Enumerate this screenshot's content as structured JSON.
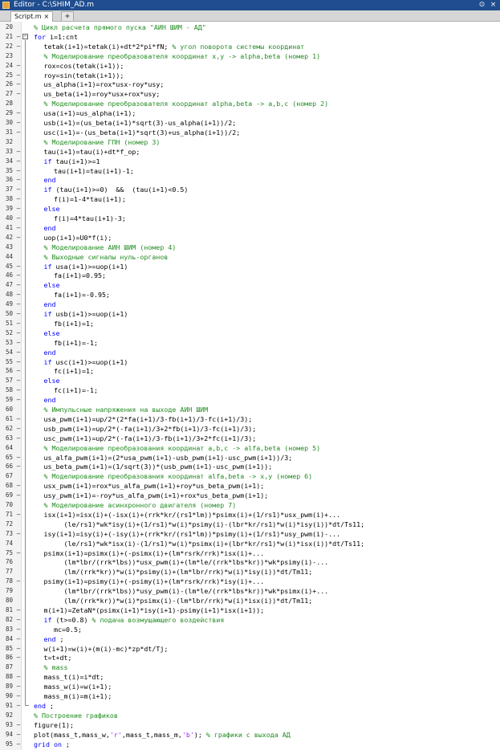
{
  "window": {
    "title": "Editor - C:\\SHIM_AD.m",
    "menu_icon": "chevron-down-circle-icon",
    "close_icon": "close-icon"
  },
  "tabs": {
    "active": "Script.m",
    "close_glyph": "×",
    "add_glyph": "+"
  },
  "colors": {
    "keyword": "#0000ff",
    "comment": "#228b22",
    "string": "#a020f0",
    "titlebar": "#1f4d8f"
  },
  "editor": {
    "lines": [
      {
        "n": "20",
        "m": "",
        "ind": 0,
        "fold": "",
        "t": [
          [
            "cm",
            "% Цикл расчета прямого пуска \"АИН ШИМ - АД\""
          ]
        ]
      },
      {
        "n": "21",
        "m": "—",
        "ind": 0,
        "fold": "open",
        "t": [
          [
            "kw",
            "for"
          ],
          [
            "",
            "i=1:cnt"
          ]
        ]
      },
      {
        "n": "22",
        "m": "—",
        "ind": 1,
        "fold": "",
        "t": [
          [
            "",
            "tetak(i+1)=tetak(i)+dt*2*pi*fN; "
          ],
          [
            "cm",
            "% угол поворота системы координат"
          ]
        ]
      },
      {
        "n": "23",
        "m": "",
        "ind": 1,
        "fold": "",
        "t": [
          [
            "cm",
            "% Моделирование преобразователя координат x,y -> alpha,beta (номер 1)"
          ]
        ]
      },
      {
        "n": "24",
        "m": "—",
        "ind": 1,
        "fold": "",
        "t": [
          [
            "",
            "rox=cos(tetak(i+1));"
          ]
        ]
      },
      {
        "n": "25",
        "m": "—",
        "ind": 1,
        "fold": "",
        "t": [
          [
            "",
            "roy=sin(tetak(i+1));"
          ]
        ]
      },
      {
        "n": "26",
        "m": "—",
        "ind": 1,
        "fold": "",
        "t": [
          [
            "",
            "us_alpha(i+1)=rox*usx-roy*usy;"
          ]
        ]
      },
      {
        "n": "27",
        "m": "—",
        "ind": 1,
        "fold": "",
        "t": [
          [
            "",
            "us_beta(i+1)=roy*usx+rox*usy;"
          ]
        ]
      },
      {
        "n": "28",
        "m": "",
        "ind": 1,
        "fold": "",
        "t": [
          [
            "cm",
            "% Моделирование преобразователя координат alpha,beta -> a,b,c (номер 2)"
          ]
        ]
      },
      {
        "n": "29",
        "m": "—",
        "ind": 1,
        "fold": "",
        "t": [
          [
            "",
            "usa(i+1)=us_alpha(i+1);"
          ]
        ]
      },
      {
        "n": "30",
        "m": "—",
        "ind": 1,
        "fold": "",
        "t": [
          [
            "",
            "usb(i+1)=(us_beta(i+1)*sqrt(3)-us_alpha(i+1))/2;"
          ]
        ]
      },
      {
        "n": "31",
        "m": "—",
        "ind": 1,
        "fold": "",
        "t": [
          [
            "",
            "usc(i+1)=-(us_beta(i+1)*sqrt(3)+us_alpha(i+1))/2;"
          ]
        ]
      },
      {
        "n": "32",
        "m": "",
        "ind": 1,
        "fold": "",
        "t": [
          [
            "cm",
            "% Моделирование ГПН (номер 3)"
          ]
        ]
      },
      {
        "n": "33",
        "m": "—",
        "ind": 1,
        "fold": "",
        "t": [
          [
            "",
            "tau(i+1)=tau(i)+dt*f_op;"
          ]
        ]
      },
      {
        "n": "34",
        "m": "—",
        "ind": 1,
        "fold": "",
        "t": [
          [
            "kw",
            "if"
          ],
          [
            "",
            "tau(i+1)>=1"
          ]
        ]
      },
      {
        "n": "35",
        "m": "—",
        "ind": 2,
        "fold": "",
        "t": [
          [
            "",
            "tau(i+1)=tau(i+1)-1;"
          ]
        ]
      },
      {
        "n": "36",
        "m": "—",
        "ind": 1,
        "fold": "",
        "t": [
          [
            "kw",
            "end"
          ]
        ]
      },
      {
        "n": "37",
        "m": "—",
        "ind": 1,
        "fold": "",
        "t": [
          [
            "kw",
            "if"
          ],
          [
            "",
            "(tau(i+1)>=0)  &&  (tau(i+1)<0.5)"
          ]
        ]
      },
      {
        "n": "38",
        "m": "—",
        "ind": 2,
        "fold": "",
        "t": [
          [
            "",
            "f(i)=1-4*tau(i+1);"
          ]
        ]
      },
      {
        "n": "39",
        "m": "—",
        "ind": 1,
        "fold": "",
        "t": [
          [
            "kw",
            "else"
          ]
        ]
      },
      {
        "n": "40",
        "m": "—",
        "ind": 2,
        "fold": "",
        "t": [
          [
            "",
            "f(i)=4*tau(i+1)-3;"
          ]
        ]
      },
      {
        "n": "41",
        "m": "—",
        "ind": 1,
        "fold": "",
        "t": [
          [
            "kw",
            "end"
          ]
        ]
      },
      {
        "n": "42",
        "m": "—",
        "ind": 1,
        "fold": "",
        "t": [
          [
            "",
            "uop(i+1)=U0*f(i);"
          ]
        ]
      },
      {
        "n": "43",
        "m": "",
        "ind": 1,
        "fold": "",
        "t": [
          [
            "cm",
            "% Моделирование АИН ШИМ (номер 4)"
          ]
        ]
      },
      {
        "n": "44",
        "m": "",
        "ind": 1,
        "fold": "",
        "t": [
          [
            "cm",
            "% Выходные сигналы нуль-органов"
          ]
        ]
      },
      {
        "n": "45",
        "m": "—",
        "ind": 1,
        "fold": "",
        "t": [
          [
            "kw",
            "if"
          ],
          [
            "",
            "usa(i+1)>=uop(i+1)"
          ]
        ]
      },
      {
        "n": "46",
        "m": "—",
        "ind": 2,
        "fold": "",
        "t": [
          [
            "",
            "fa(i+1)=0.95;"
          ]
        ]
      },
      {
        "n": "47",
        "m": "—",
        "ind": 1,
        "fold": "",
        "t": [
          [
            "kw",
            "else"
          ]
        ]
      },
      {
        "n": "48",
        "m": "—",
        "ind": 2,
        "fold": "",
        "t": [
          [
            "",
            "fa(i+1)=-0.95;"
          ]
        ]
      },
      {
        "n": "49",
        "m": "—",
        "ind": 1,
        "fold": "",
        "t": [
          [
            "kw",
            "end"
          ]
        ]
      },
      {
        "n": "50",
        "m": "—",
        "ind": 1,
        "fold": "",
        "t": [
          [
            "kw",
            "if"
          ],
          [
            "",
            "usb(i+1)>=uop(i+1)"
          ]
        ]
      },
      {
        "n": "51",
        "m": "—",
        "ind": 2,
        "fold": "",
        "t": [
          [
            "",
            "fb(i+1)=1;"
          ]
        ]
      },
      {
        "n": "52",
        "m": "—",
        "ind": 1,
        "fold": "",
        "t": [
          [
            "kw",
            "else"
          ]
        ]
      },
      {
        "n": "53",
        "m": "—",
        "ind": 2,
        "fold": "",
        "t": [
          [
            "",
            "fb(i+1)=-1;"
          ]
        ]
      },
      {
        "n": "54",
        "m": "—",
        "ind": 1,
        "fold": "",
        "t": [
          [
            "kw",
            "end"
          ]
        ]
      },
      {
        "n": "55",
        "m": "—",
        "ind": 1,
        "fold": "",
        "t": [
          [
            "kw",
            "if"
          ],
          [
            "",
            "usc(i+1)>=uop(i+1)"
          ]
        ]
      },
      {
        "n": "56",
        "m": "—",
        "ind": 2,
        "fold": "",
        "t": [
          [
            "",
            "fc(i+1)=1;"
          ]
        ]
      },
      {
        "n": "57",
        "m": "—",
        "ind": 1,
        "fold": "",
        "t": [
          [
            "kw",
            "else"
          ]
        ]
      },
      {
        "n": "58",
        "m": "—",
        "ind": 2,
        "fold": "",
        "t": [
          [
            "",
            "fc(i+1)=-1;"
          ]
        ]
      },
      {
        "n": "59",
        "m": "—",
        "ind": 1,
        "fold": "",
        "t": [
          [
            "kw",
            "end"
          ]
        ]
      },
      {
        "n": "60",
        "m": "",
        "ind": 1,
        "fold": "",
        "t": [
          [
            "cm",
            "% Импульсные напряжения на выходе АИН ШИМ"
          ]
        ]
      },
      {
        "n": "61",
        "m": "—",
        "ind": 1,
        "fold": "",
        "t": [
          [
            "",
            "usa_pwm(i+1)=up/2*(2*fa(i+1)/3-fb(i+1)/3-fc(i+1)/3);"
          ]
        ]
      },
      {
        "n": "62",
        "m": "—",
        "ind": 1,
        "fold": "",
        "t": [
          [
            "",
            "usb_pwm(i+1)=up/2*(-fa(i+1)/3+2*fb(i+1)/3-fc(i+1)/3);"
          ]
        ]
      },
      {
        "n": "63",
        "m": "—",
        "ind": 1,
        "fold": "",
        "t": [
          [
            "",
            "usc_pwm(i+1)=up/2*(-fa(i+1)/3-fb(i+1)/3+2*fc(i+1)/3);"
          ]
        ]
      },
      {
        "n": "64",
        "m": "",
        "ind": 1,
        "fold": "",
        "t": [
          [
            "cm",
            "% Моделирование преобразования координат a,b,c -> alfa,beta (номер 5)"
          ]
        ]
      },
      {
        "n": "65",
        "m": "—",
        "ind": 1,
        "fold": "",
        "t": [
          [
            "",
            "us_alfa_pwm(i+1)=(2*usa_pwm(i+1)-usb_pwm(i+1)-usc_pwm(i+1))/3;"
          ]
        ]
      },
      {
        "n": "66",
        "m": "—",
        "ind": 1,
        "fold": "",
        "t": [
          [
            "",
            "us_beta_pwm(i+1)=(1/sqrt(3))*(usb_pwm(i+1)-usc_pwm(i+1));"
          ]
        ]
      },
      {
        "n": "67",
        "m": "",
        "ind": 1,
        "fold": "",
        "t": [
          [
            "cm",
            "% Моделирование преобразования координат alfa,beta -> x,y (номер 6)"
          ]
        ]
      },
      {
        "n": "68",
        "m": "—",
        "ind": 1,
        "fold": "",
        "t": [
          [
            "",
            "usx_pwm(i+1)=rox*us_alfa_pwm(i+1)+roy*us_beta_pwm(i+1);"
          ]
        ]
      },
      {
        "n": "69",
        "m": "—",
        "ind": 1,
        "fold": "",
        "t": [
          [
            "",
            "usy_pwm(i+1)=-roy*us_alfa_pwm(i+1)+rox*us_beta_pwm(i+1);"
          ]
        ]
      },
      {
        "n": "70",
        "m": "",
        "ind": 1,
        "fold": "",
        "t": [
          [
            "cm",
            "% Моделирование асинхронного двигателя (номер 7)"
          ]
        ]
      },
      {
        "n": "71",
        "m": "—",
        "ind": 1,
        "fold": "",
        "t": [
          [
            "",
            "isx(i+1)=isx(i)+(-isx(i)+(rrk*kr/(rs1*lm))*psimx(i)+(1/rs1)*usx_pwm(i)+..."
          ]
        ]
      },
      {
        "n": "72",
        "m": "",
        "ind": 3,
        "fold": "",
        "t": [
          [
            "",
            "(le/rs1)*wk*isy(i)+(1/rs1)*w(i)*psimy(i)-(lbr*kr/rs1)*w(i)*isy(i))*dt/Ts11;"
          ]
        ]
      },
      {
        "n": "73",
        "m": "—",
        "ind": 1,
        "fold": "",
        "t": [
          [
            "",
            "isy(i+1)=isy(i)+(-isy(i)+(rrk*kr/(rs1*lm))*psimy(i)+(1/rs1)*usy_pwm(i)-..."
          ]
        ]
      },
      {
        "n": "74",
        "m": "",
        "ind": 3,
        "fold": "",
        "t": [
          [
            "",
            "(le/rs1)*wk*isx(i)-(1/rs1)*w(i)*psimx(i)+(lbr*kr/rs1)*w(i)*isx(i))*dt/Ts11;"
          ]
        ]
      },
      {
        "n": "75",
        "m": "—",
        "ind": 1,
        "fold": "",
        "t": [
          [
            "",
            "psimx(i+1)=psimx(i)+(-psimx(i)+(lm*rsrk/rrk)*isx(i)+..."
          ]
        ]
      },
      {
        "n": "76",
        "m": "",
        "ind": 3,
        "fold": "",
        "t": [
          [
            "",
            "(lm*lbr/(rrk*lbs))*usx_pwm(i)+(lm*le/(rrk*lbs*kr))*wk*psimy(i)-..."
          ]
        ]
      },
      {
        "n": "77",
        "m": "",
        "ind": 3,
        "fold": "",
        "t": [
          [
            "",
            "(lm/(rrk*kr))*w(i)*psimy(i)+(lm*lbr/rrk)*w(i)*isy(i))*dt/Tm11;"
          ]
        ]
      },
      {
        "n": "78",
        "m": "—",
        "ind": 1,
        "fold": "",
        "t": [
          [
            "",
            "psimy(i+1)=psimy(i)+(-psimy(i)+(lm*rsrk/rrk)*isy(i)+..."
          ]
        ]
      },
      {
        "n": "79",
        "m": "",
        "ind": 3,
        "fold": "",
        "t": [
          [
            "",
            "(lm*lbr/(rrk*lbs))*usy_pwm(i)-(lm*le/(rrk*lbs*kr))*wk*psimx(i)+..."
          ]
        ]
      },
      {
        "n": "80",
        "m": "",
        "ind": 3,
        "fold": "",
        "t": [
          [
            "",
            "(lm/(rrk*kr))*w(i)*psimx(i)-(lm*lbr/rrk)*w(i)*isx(i))*dt/Tm11;"
          ]
        ]
      },
      {
        "n": "81",
        "m": "—",
        "ind": 1,
        "fold": "",
        "t": [
          [
            "",
            "m(i+1)=ZetaN*(psimx(i+1)*isy(i+1)-psimy(i+1)*isx(i+1));"
          ]
        ]
      },
      {
        "n": "82",
        "m": "—",
        "ind": 1,
        "fold": "",
        "t": [
          [
            "kw",
            "if"
          ],
          [
            "",
            "(t>=0.8) "
          ],
          [
            "cm",
            "% подача возмущающего воздействия"
          ]
        ]
      },
      {
        "n": "83",
        "m": "—",
        "ind": 2,
        "fold": "",
        "t": [
          [
            "",
            "mc=0.5;"
          ]
        ]
      },
      {
        "n": "84",
        "m": "—",
        "ind": 1,
        "fold": "",
        "t": [
          [
            "kw",
            "end"
          ],
          [
            "",
            ";"
          ]
        ]
      },
      {
        "n": "85",
        "m": "—",
        "ind": 1,
        "fold": "",
        "t": [
          [
            "",
            "w(i+1)=w(i)+(m(i)-mc)*zp*dt/Tj;"
          ]
        ]
      },
      {
        "n": "86",
        "m": "—",
        "ind": 1,
        "fold": "",
        "t": [
          [
            "",
            "t=t+dt;"
          ]
        ]
      },
      {
        "n": "87",
        "m": "",
        "ind": 1,
        "fold": "",
        "t": [
          [
            "cm",
            "% mass"
          ]
        ]
      },
      {
        "n": "88",
        "m": "—",
        "ind": 1,
        "fold": "",
        "t": [
          [
            "",
            "mass_t(i)=i*dt;"
          ]
        ]
      },
      {
        "n": "89",
        "m": "—",
        "ind": 1,
        "fold": "",
        "t": [
          [
            "",
            "mass_w(i)=w(i+1);"
          ]
        ]
      },
      {
        "n": "90",
        "m": "—",
        "ind": 1,
        "fold": "",
        "t": [
          [
            "",
            "mass_m(i)=m(i+1);"
          ]
        ]
      },
      {
        "n": "91",
        "m": "—",
        "ind": 0,
        "fold": "end",
        "t": [
          [
            "kw",
            "end"
          ],
          [
            "",
            ";"
          ]
        ]
      },
      {
        "n": "92",
        "m": "",
        "ind": 0,
        "fold": "",
        "t": [
          [
            "cm",
            "% Построение графиков"
          ]
        ]
      },
      {
        "n": "93",
        "m": "—",
        "ind": 0,
        "fold": "",
        "t": [
          [
            "",
            "figure(1);"
          ]
        ]
      },
      {
        "n": "94",
        "m": "—",
        "ind": 0,
        "fold": "",
        "t": [
          [
            "",
            "plot(mass_t,mass_w,"
          ],
          [
            "st",
            "'r'"
          ],
          [
            "",
            ",mass_t,mass_m,"
          ],
          [
            "st",
            "'b'"
          ],
          [
            "",
            "); "
          ],
          [
            "cm",
            "% графики с выхода АД"
          ]
        ]
      },
      {
        "n": "95",
        "m": "—",
        "ind": 0,
        "fold": "",
        "t": [
          [
            "kw",
            "grid"
          ],
          [
            "",
            ""
          ],
          [
            "kw",
            "on"
          ],
          [
            "",
            ";"
          ]
        ]
      }
    ]
  }
}
